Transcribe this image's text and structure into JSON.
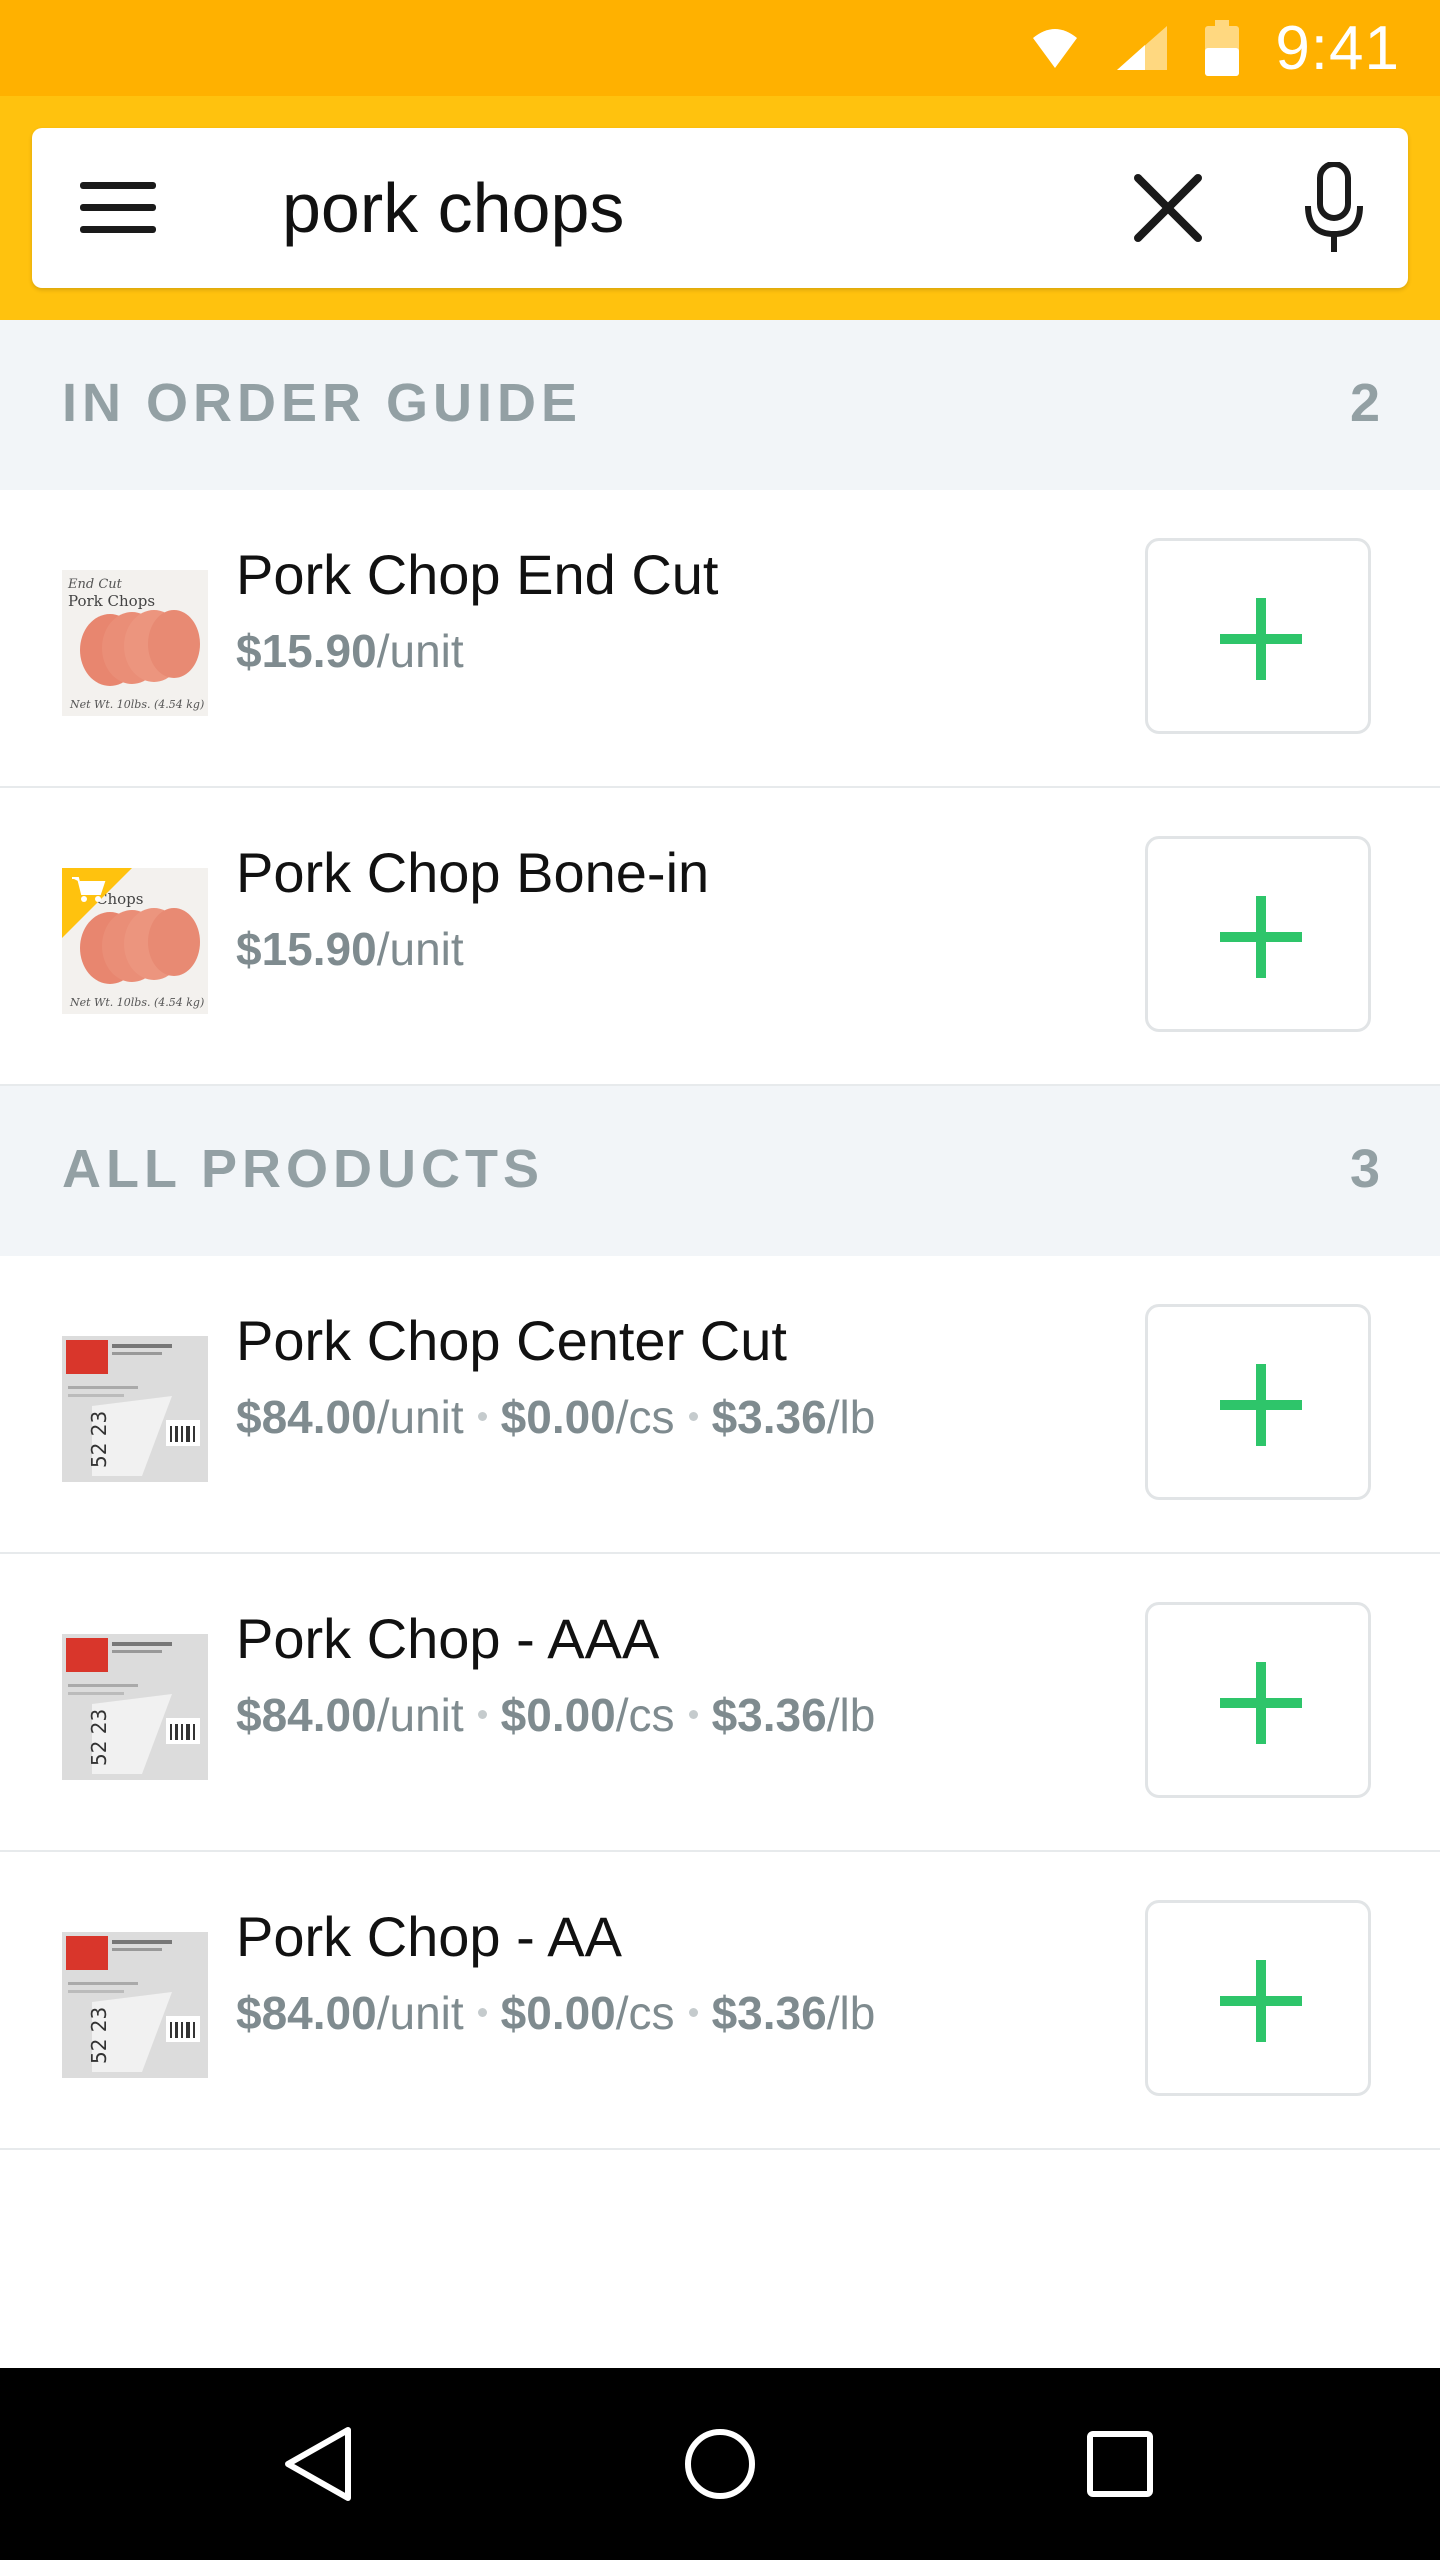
{
  "status_bar": {
    "time": "9:41"
  },
  "search": {
    "value": "pork chops"
  },
  "sections": [
    {
      "title": "IN ORDER GUIDE",
      "count": "2",
      "products": [
        {
          "name": "Pork Chop End Cut",
          "prices": [
            {
              "amount": "$15.90",
              "unit": "/unit"
            }
          ],
          "in_cart": false
        },
        {
          "name": "Pork Chop Bone-in",
          "prices": [
            {
              "amount": "$15.90",
              "unit": "/unit"
            }
          ],
          "in_cart": true
        }
      ]
    },
    {
      "title": "ALL PRODUCTS",
      "count": "3",
      "products": [
        {
          "name": "Pork Chop Center Cut",
          "prices": [
            {
              "amount": "$84.00",
              "unit": "/unit"
            },
            {
              "amount": "$0.00",
              "unit": "/cs"
            },
            {
              "amount": "$3.36",
              "unit": "/lb"
            }
          ]
        },
        {
          "name": "Pork Chop - AAA",
          "prices": [
            {
              "amount": "$84.00",
              "unit": "/unit"
            },
            {
              "amount": "$0.00",
              "unit": "/cs"
            },
            {
              "amount": "$3.36",
              "unit": "/lb"
            }
          ]
        },
        {
          "name": "Pork Chop - AA",
          "prices": [
            {
              "amount": "$84.00",
              "unit": "/unit"
            },
            {
              "amount": "$0.00",
              "unit": "/cs"
            },
            {
              "amount": "$3.36",
              "unit": "/lb"
            }
          ]
        }
      ]
    }
  ],
  "thumbnails": {
    "fresh_pack": {
      "label_line1": "End Cut",
      "label_line2": "Pork Chops",
      "weight": "Net Wt. 10lbs. (4.54 kg)"
    },
    "fresh_pack_cart": {
      "label_line2": "Chops",
      "weight": "Net Wt. 10lbs. (4.54 kg)"
    },
    "frozen_box": {
      "code": "52 23"
    }
  },
  "icons": {
    "menu": "menu-icon",
    "clear": "close-icon",
    "mic": "microphone-icon",
    "add": "plus-icon",
    "cart": "cart-icon",
    "back": "back-icon",
    "home": "home-icon",
    "recents": "recents-icon",
    "wifi": "wifi-icon",
    "signal": "signal-icon",
    "battery": "battery-icon"
  },
  "colors": {
    "status_bar": "#ffb100",
    "toolbar": "#ffc20e",
    "add_green": "#2ec56a",
    "section_text": "#93a0a4"
  }
}
